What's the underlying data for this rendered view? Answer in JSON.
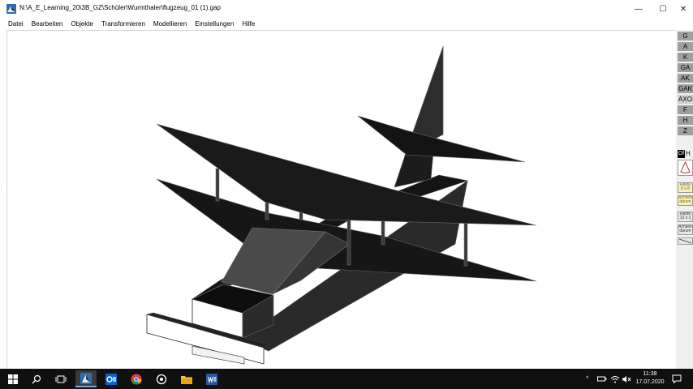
{
  "window": {
    "title": "N:\\A_E_Learning_20\\3B_GZ\\Schüler\\Wurmthaler\\flugzeug_01 (1).gap",
    "minimize": "—",
    "maximize": "☐",
    "close": "✕"
  },
  "menu": {
    "items": [
      "Datei",
      "Bearbeiten",
      "Objekte",
      "Transformieren",
      "Modellieren",
      "Einstellungen",
      "Hilfe"
    ]
  },
  "right_panel": {
    "view_buttons": [
      "G",
      "A",
      "K",
      "GA",
      "AK",
      "GAK",
      "AXO",
      "F",
      "H",
      "Z"
    ],
    "of_label": "Of",
    "h_label": "H",
    "raster1": "Raste 8 x 8",
    "achsen1": "Achsen darum",
    "raster2": "Raste 12 x 1",
    "achsen2": "Achsen darum"
  },
  "taskbar": {
    "time": "11:38",
    "date": "17.07.2020",
    "tray_chevron": "^"
  },
  "colors": {
    "accent": "#7aa7d8",
    "model_dark": "#1e1e1e",
    "taskbar": "#101010"
  }
}
